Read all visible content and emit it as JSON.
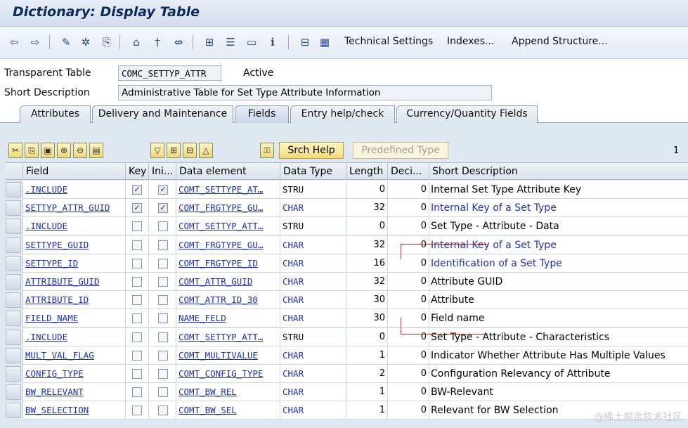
{
  "window": {
    "title": "Dictionary: Display Table"
  },
  "toolbar": {
    "links": [
      "Technical Settings",
      "Indexes...",
      "Append Structure..."
    ]
  },
  "header": {
    "table_type_label": "Transparent Table",
    "table_name": "COMC_SETTYP_ATTR",
    "status": "Active",
    "short_desc_label": "Short Description",
    "short_desc": "Administrative Table for Set Type Attribute Information"
  },
  "tabs": [
    {
      "label": "Attributes"
    },
    {
      "label": "Delivery and Maintenance"
    },
    {
      "label": "Fields"
    },
    {
      "label": "Entry help/check"
    },
    {
      "label": "Currency/Quantity Fields"
    }
  ],
  "buttons": {
    "srch_help": "Srch Help",
    "predefined_type": "Predefined Type",
    "page": "1"
  },
  "columns": [
    "Field",
    "Key",
    "Ini...",
    "Data element",
    "Data Type",
    "Length",
    "Deci...",
    "Short Description"
  ],
  "rows": [
    {
      "field": ".INCLUDE",
      "key": true,
      "ini": true,
      "elem": "COMT_SETTYPE_AT…",
      "type": "STRU",
      "len": "0",
      "dec": "0",
      "desc": "Internal Set Type Attribute Key"
    },
    {
      "field": "SETTYP_ATTR_GUID",
      "key": true,
      "ini": true,
      "elem": "COMT_FRGTYPE_GU…",
      "type": "CHAR",
      "len": "32",
      "dec": "0",
      "desc": "Internal Key of a Set Type"
    },
    {
      "field": ".INCLUDE",
      "key": false,
      "ini": false,
      "elem": "COMT_SETTYP_ATT…",
      "type": "STRU",
      "len": "0",
      "dec": "0",
      "desc": "Set Type - Attribute - Data"
    },
    {
      "field": "SETTYPE_GUID",
      "key": false,
      "ini": false,
      "elem": "COMT_FRGTYPE_GU…",
      "type": "CHAR",
      "len": "32",
      "dec": "0",
      "desc": "Internal Key of a Set Type"
    },
    {
      "field": "SETTYPE_ID",
      "key": false,
      "ini": false,
      "elem": "COMT_FRGTYPE_ID",
      "type": "CHAR",
      "len": "16",
      "dec": "0",
      "desc": "Identification of a Set Type"
    },
    {
      "field": "ATTRIBUTE_GUID",
      "key": false,
      "ini": false,
      "elem": "COMT_ATTR_GUID",
      "type": "CHAR",
      "len": "32",
      "dec": "0",
      "desc": "Attribute GUID"
    },
    {
      "field": "ATTRIBUTE_ID",
      "key": false,
      "ini": false,
      "elem": "COMT_ATTR_ID_30",
      "type": "CHAR",
      "len": "30",
      "dec": "0",
      "desc": "Attribute"
    },
    {
      "field": "FIELD_NAME",
      "key": false,
      "ini": false,
      "elem": "NAME_FELD",
      "type": "CHAR",
      "len": "30",
      "dec": "0",
      "desc": "Field name"
    },
    {
      "field": ".INCLUDE",
      "key": false,
      "ini": false,
      "elem": "COMT_SETTYP_ATT…",
      "type": "STRU",
      "len": "0",
      "dec": "0",
      "desc": "Set Type - Attribute - Characteristics"
    },
    {
      "field": "MULT_VAL_FLAG",
      "key": false,
      "ini": false,
      "elem": "COMT_MULTIVALUE",
      "type": "CHAR",
      "len": "1",
      "dec": "0",
      "desc": "Indicator Whether Attribute Has Multiple Values"
    },
    {
      "field": "CONFIG_TYPE",
      "key": false,
      "ini": false,
      "elem": "COMT_CONFIG_TYPE",
      "type": "CHAR",
      "len": "2",
      "dec": "0",
      "desc": "Configuration Relevancy of Attribute"
    },
    {
      "field": "BW_RELEVANT",
      "key": false,
      "ini": false,
      "elem": "COMT_BW_REL",
      "type": "CHAR",
      "len": "1",
      "dec": "0",
      "desc": "BW-Relevant"
    },
    {
      "field": "BW_SELECTION",
      "key": false,
      "ini": false,
      "elem": "COMT_BW_SEL",
      "type": "CHAR",
      "len": "1",
      "dec": "0",
      "desc": "Relevant for BW Selection"
    }
  ],
  "watermark": "@稀土掘金技术社区",
  "colors": {
    "link": "#1c2fb8",
    "title": "#0b2a5c",
    "annotation": "#d32a2a"
  }
}
